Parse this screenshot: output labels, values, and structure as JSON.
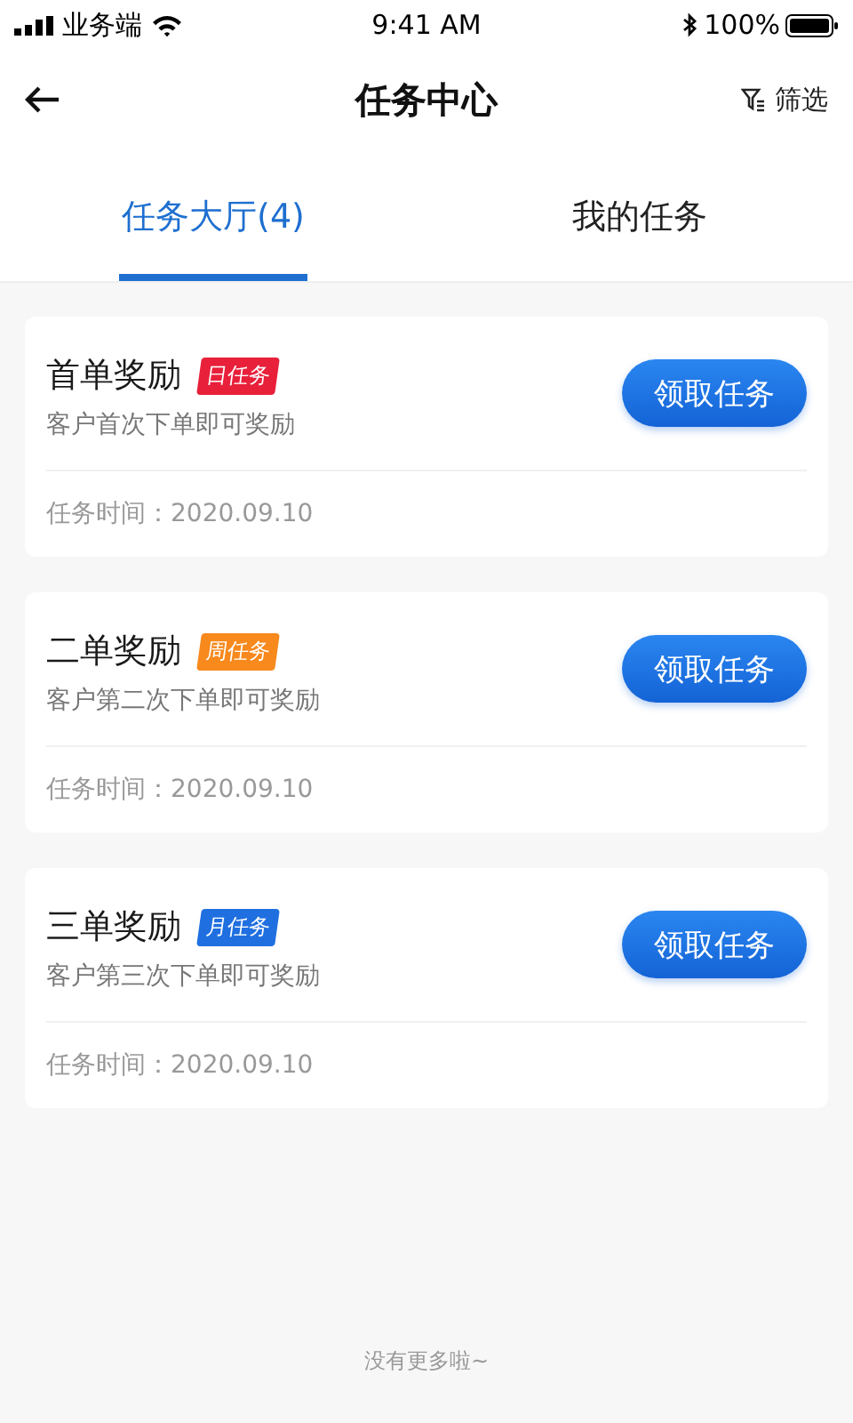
{
  "status_bar": {
    "carrier": "业务端",
    "time": "9:41 AM",
    "battery": "100%"
  },
  "nav": {
    "title": "任务中心",
    "filter": "筛选"
  },
  "tabs": [
    {
      "label": "任务大厅(4)",
      "selected": true
    },
    {
      "label": "我的任务",
      "selected": false
    }
  ],
  "tasks": [
    {
      "title": "首单奖励",
      "tag": "日任务",
      "color": "#e8203a",
      "description": "客户首次下单即可奖励",
      "time": "任务时间：2020.09.10",
      "button": "领取任务"
    },
    {
      "title": "二单奖励",
      "tag": "周任务",
      "color": "#f7891d",
      "description": "客户第二次下单即可奖励",
      "time": "任务时间：2020.09.10",
      "button": "领取任务"
    },
    {
      "title": "三单奖励",
      "tag": "月任务",
      "color": "#1f6fe0",
      "description": "客户第三次下单即可奖励",
      "time": "任务时间：2020.09.10",
      "button": "领取任务"
    }
  ],
  "footer": "没有更多啦~"
}
